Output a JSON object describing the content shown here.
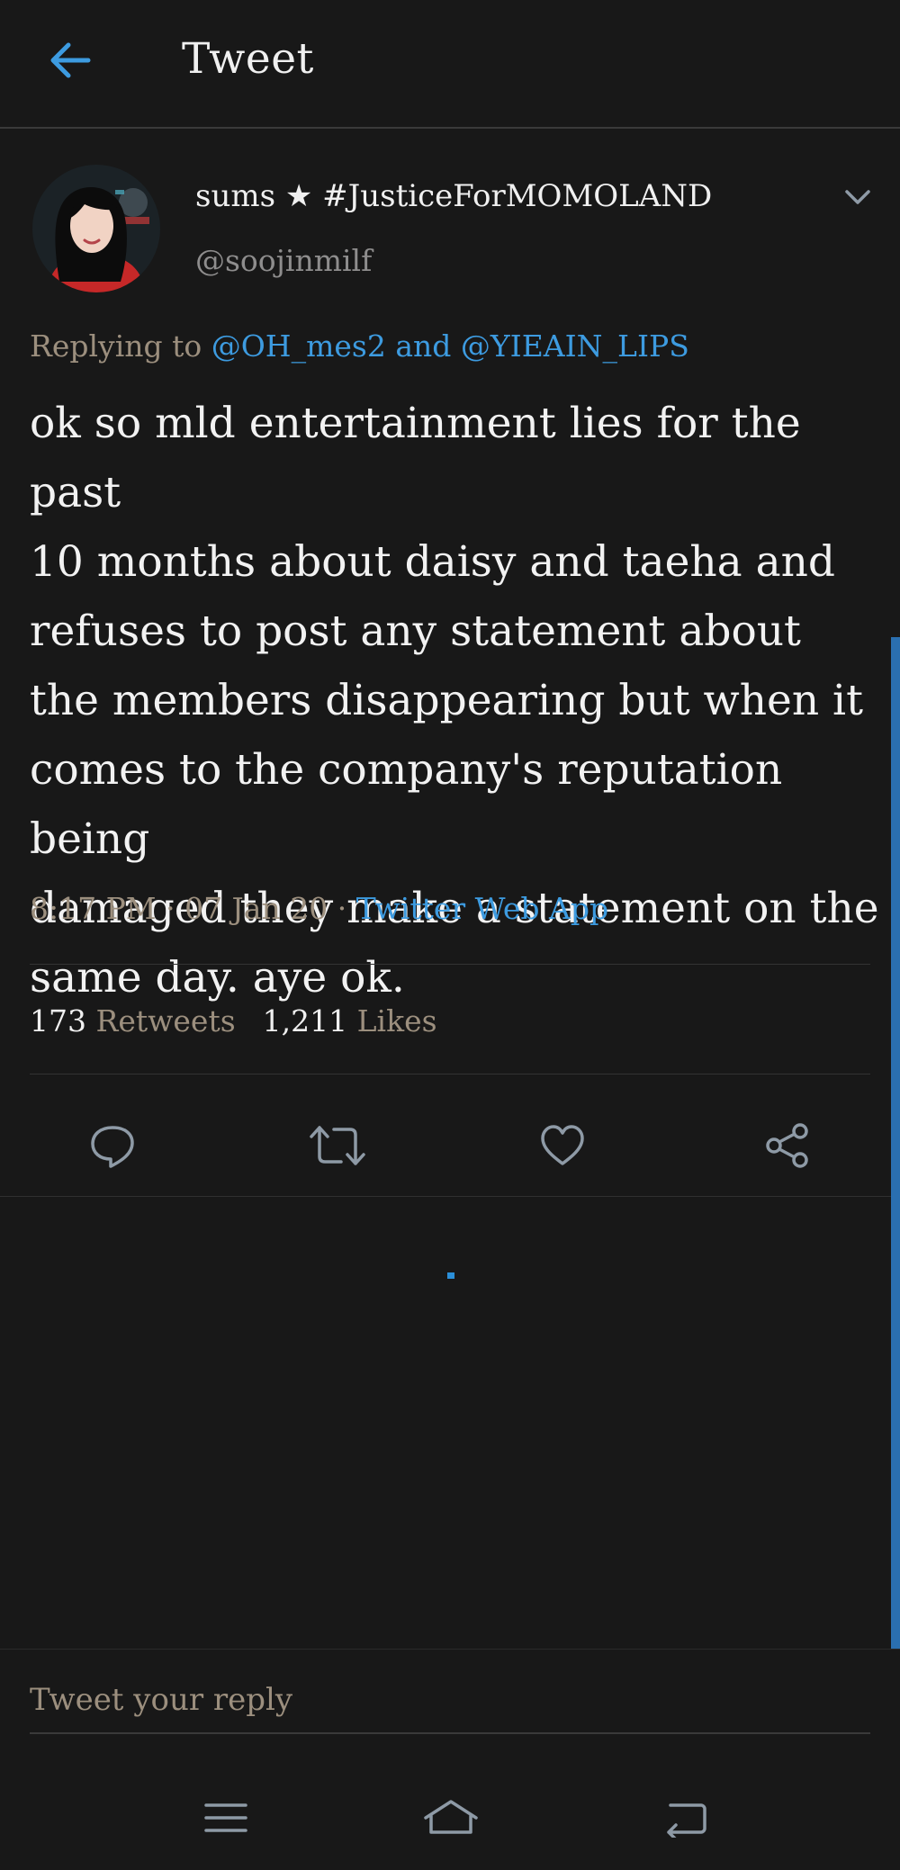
{
  "header": {
    "title": "Tweet",
    "back_icon": "arrow-left-icon"
  },
  "colors": {
    "background": "#181818",
    "accent": "#3d9be0",
    "muted": "#9c8f7e",
    "text": "#f2f2f2"
  },
  "tweet": {
    "display_name": "sums ★ #JusticeForMOMOLAND",
    "handle": "@soojinmilf",
    "reply_prefix": "Replying to ",
    "reply_to_1": "@OH_mes2",
    "reply_joiner": " and ",
    "reply_to_2": "@YIEAIN_LIPS",
    "text": "ok so mld entertainment lies for the past\n10 months about daisy and taeha and\nrefuses to post any statement about\nthe members disappearing but when it\ncomes to the company's reputation being\ndamaged they make a statement on the\nsame day. aye ok.",
    "time": "8:17 PM",
    "separator": " · ",
    "date": "07 Jan 20",
    "source": "Twitter Web App",
    "retweets_count": "173",
    "retweets_label": "Retweets",
    "likes_count": "1,211",
    "likes_label": "Likes"
  },
  "actions": [
    {
      "name": "reply",
      "icon": "comment-icon"
    },
    {
      "name": "retweet",
      "icon": "retweet-icon"
    },
    {
      "name": "like",
      "icon": "heart-icon"
    },
    {
      "name": "share",
      "icon": "share-icon"
    }
  ],
  "reply_bar": {
    "placeholder": "Tweet your reply"
  },
  "navbar": [
    {
      "name": "recents",
      "icon": "menu-icon"
    },
    {
      "name": "home",
      "icon": "home-icon"
    },
    {
      "name": "back",
      "icon": "back-icon"
    }
  ]
}
